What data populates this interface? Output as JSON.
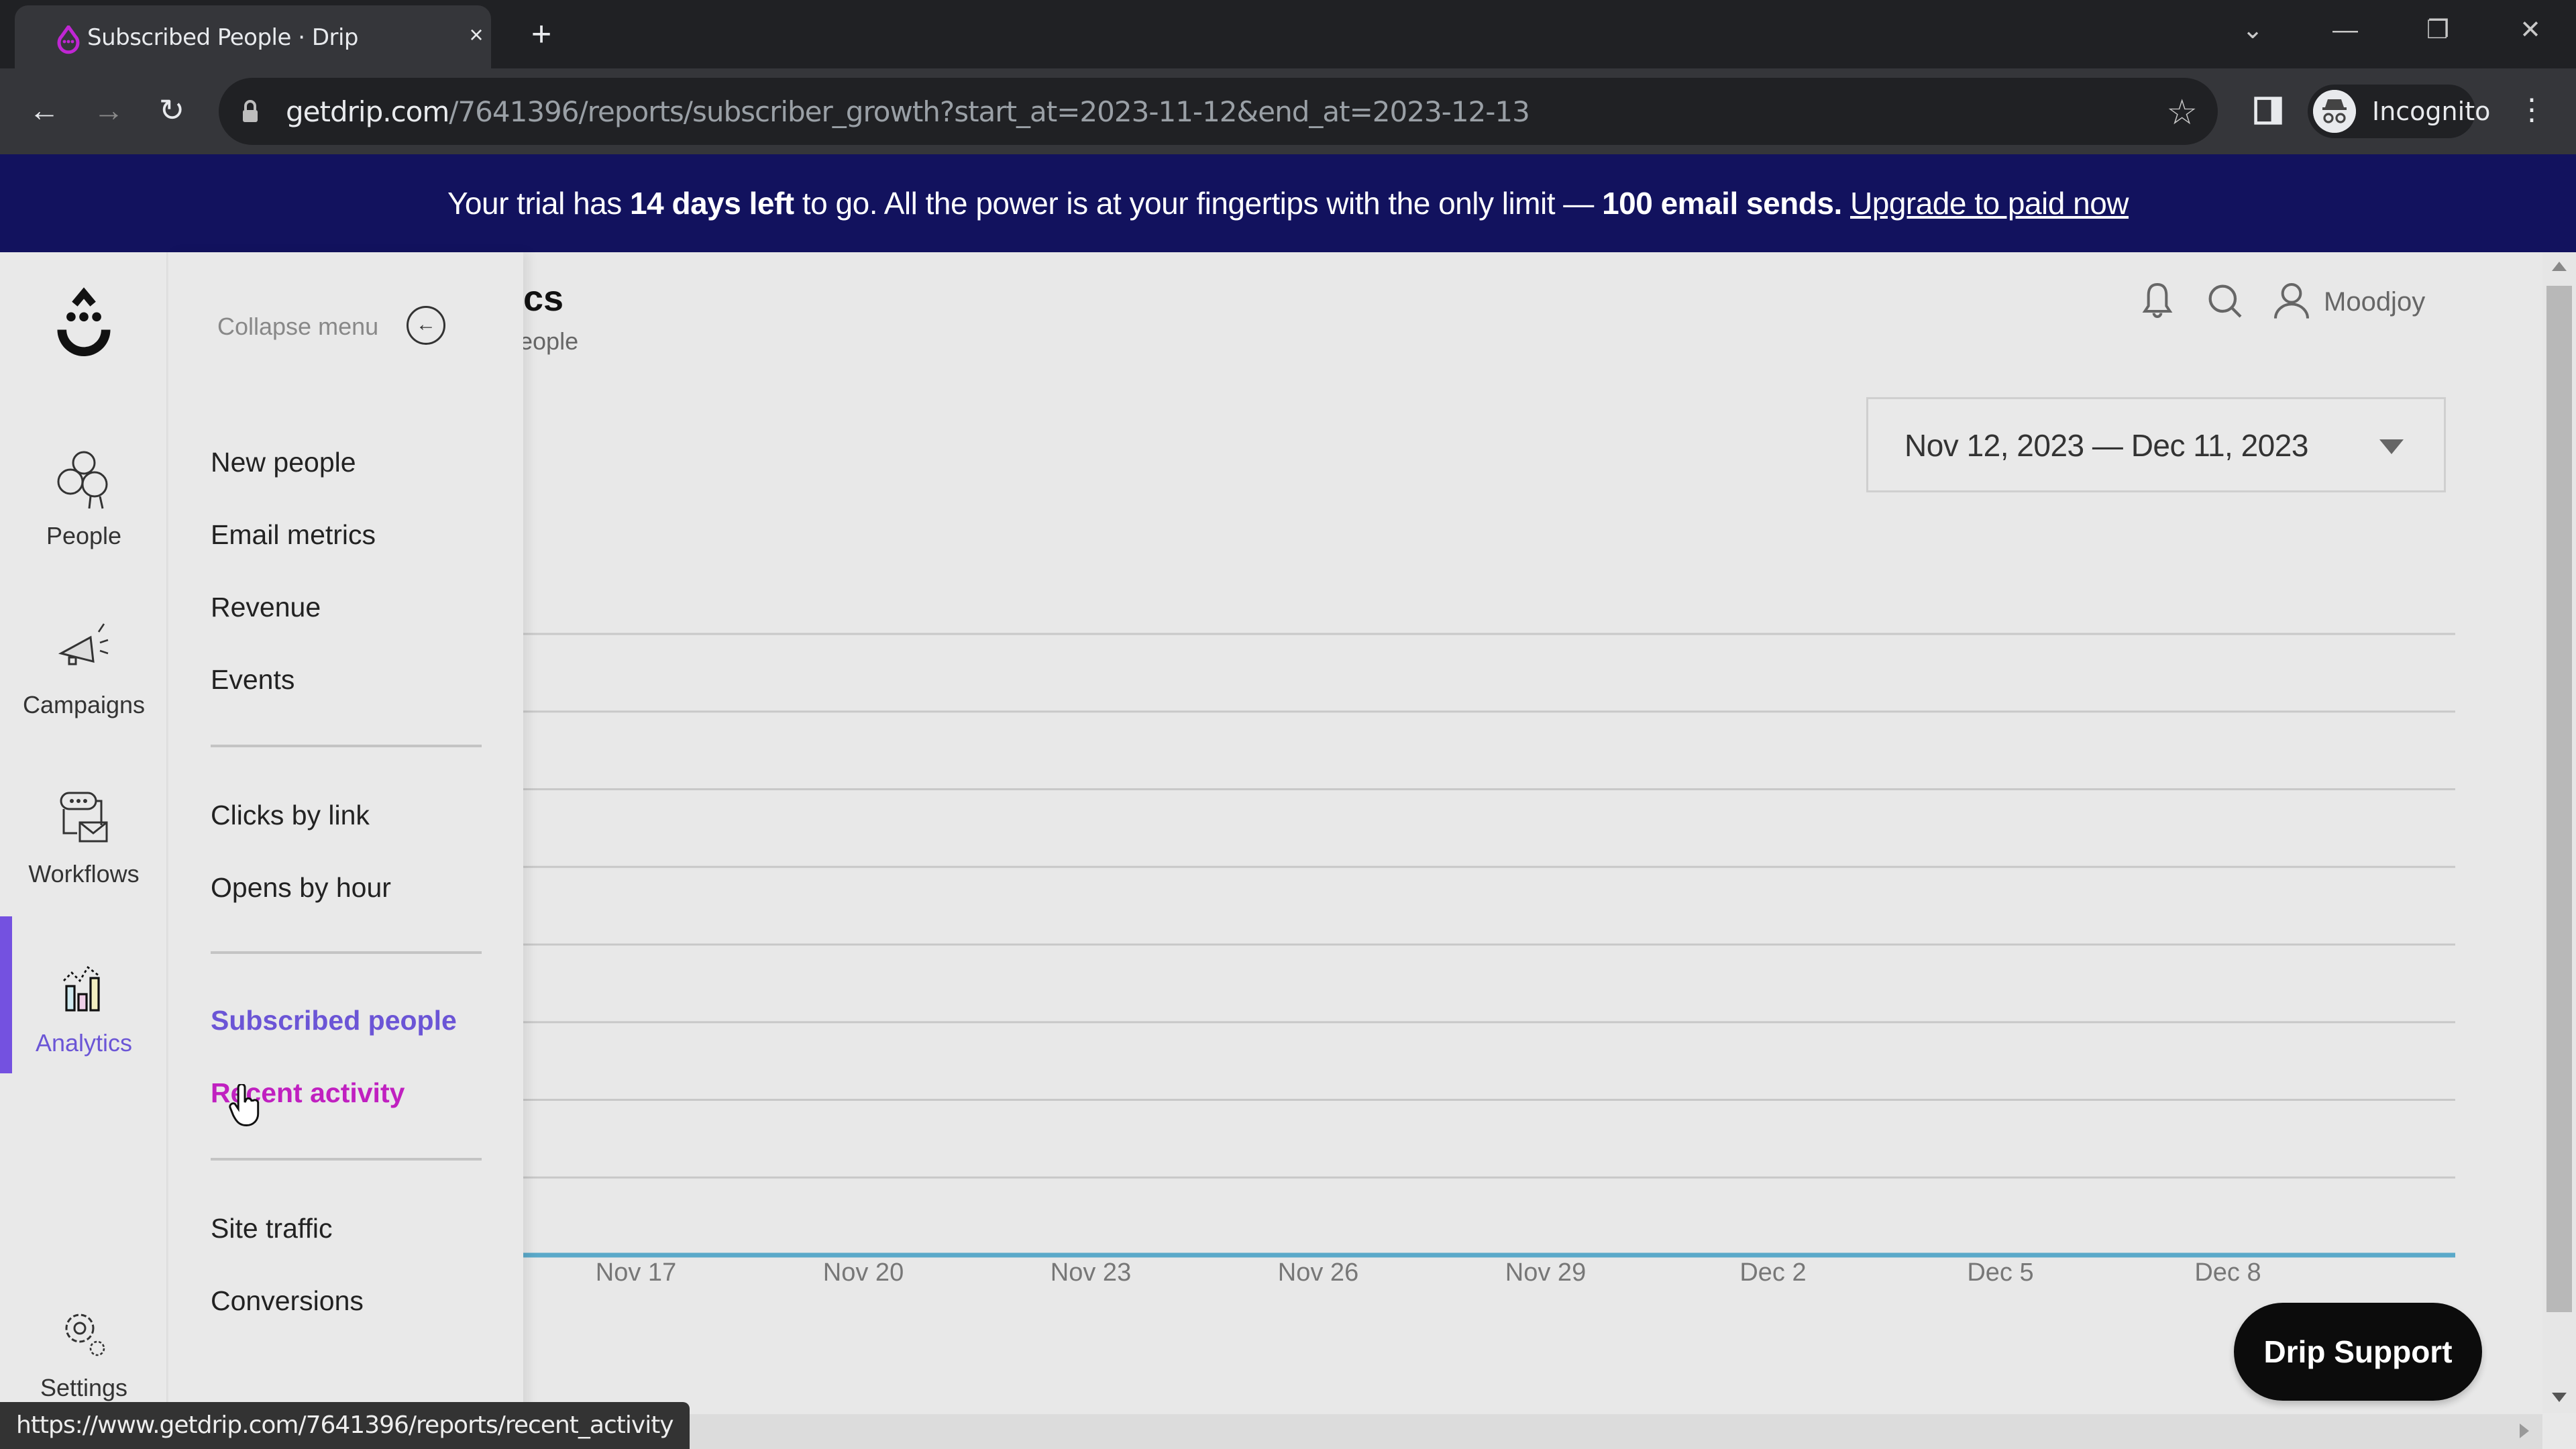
{
  "browser": {
    "tab_title": "Subscribed People · Drip",
    "tab_close": "×",
    "new_tab": "+",
    "url_host": "getdrip.com",
    "url_path": "/7641396/reports/subscriber_growth?start_at=2023-11-12&end_at=2023-12-13",
    "profile_label": "Incognito",
    "status_url": "https://www.getdrip.com/7641396/reports/recent_activity",
    "window_controls": [
      "⌄",
      "—",
      "❐",
      "✕"
    ]
  },
  "banner": {
    "prefix": "Your trial has ",
    "days_left": "14 days left",
    "middle": " to go. All the power is at your fingertips with the only limit — ",
    "limit": "100 email sends.",
    "link": "Upgrade to paid now"
  },
  "rail": {
    "items": [
      {
        "label": "People",
        "icon": "people-icon"
      },
      {
        "label": "Campaigns",
        "icon": "megaphone-icon"
      },
      {
        "label": "Workflows",
        "icon": "workflow-icon"
      },
      {
        "label": "Analytics",
        "icon": "analytics-icon",
        "active": true
      },
      {
        "label": "Settings",
        "icon": "gear-icon"
      }
    ]
  },
  "submenu": {
    "collapse_label": "Collapse menu",
    "items": [
      {
        "label": "New people"
      },
      {
        "label": "Email metrics"
      },
      {
        "label": "Revenue"
      },
      {
        "label": "Events"
      },
      {
        "label": "Clicks by link"
      },
      {
        "label": "Opens by hour"
      },
      {
        "label": "Subscribed people",
        "state": "active"
      },
      {
        "label": "Recent activity",
        "state": "hover"
      },
      {
        "label": "Site traffic"
      },
      {
        "label": "Conversions"
      }
    ]
  },
  "header": {
    "title_visible": "cs",
    "subtitle_visible": "eople",
    "user_name": "Moodjoy"
  },
  "date_range": {
    "value": "Nov 12, 2023 — Dec 11, 2023"
  },
  "colors": {
    "accent": "#6b55d6",
    "hover": "#c020c0",
    "banner_bg": "#12125e",
    "series_line": "#5aa9c9",
    "gridline": "#c8c8c8"
  },
  "chart_data": {
    "type": "line",
    "title": "",
    "xlabel": "",
    "ylabel": "",
    "x_ticks": [
      "Nov 17",
      "Nov 20",
      "Nov 23",
      "Nov 26",
      "Nov 29",
      "Dec 2",
      "Dec 5",
      "Dec 8"
    ],
    "series": [
      {
        "name": "Subscribed people",
        "x_range": [
          "Nov 12",
          "Dec 11"
        ],
        "values": [
          0,
          0,
          0,
          0,
          0,
          0,
          0,
          0,
          0,
          0,
          0,
          0,
          0,
          0,
          0,
          0,
          0,
          0,
          0,
          0,
          0,
          0,
          0,
          0,
          0,
          0,
          0,
          0,
          0,
          0
        ]
      }
    ],
    "gridlines": 8,
    "grid": true,
    "legend": "none"
  },
  "support": {
    "label": "Drip Support"
  }
}
